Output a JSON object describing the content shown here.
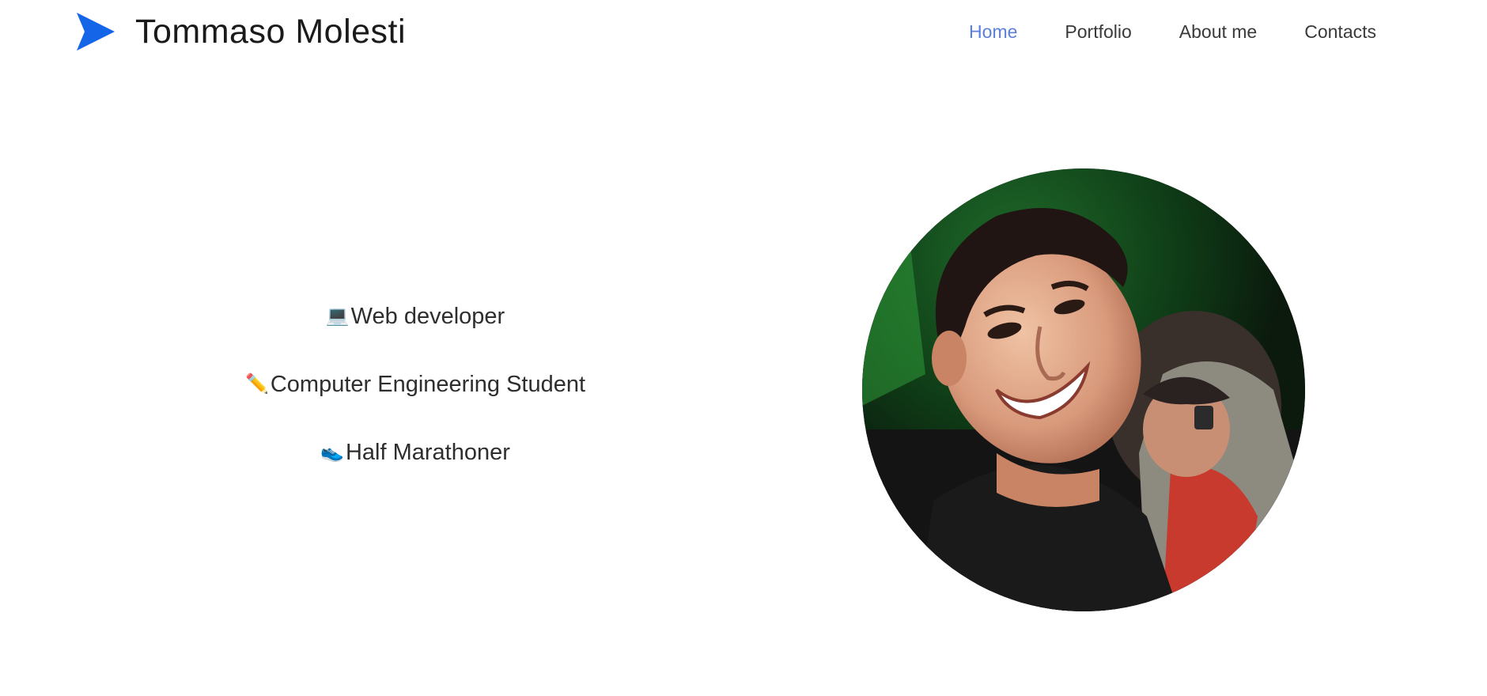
{
  "header": {
    "brand_name": "Tommaso Molesti",
    "logo_icon": "arrowhead-icon",
    "logo_color": "#1565e8"
  },
  "nav": {
    "items": [
      {
        "label": "Home",
        "active": true
      },
      {
        "label": "Portfolio",
        "active": false
      },
      {
        "label": "About me",
        "active": false
      },
      {
        "label": "Contacts",
        "active": false
      }
    ],
    "active_color": "#5b7ee0"
  },
  "main": {
    "roles": [
      {
        "emoji": "💻",
        "text": "Web developer"
      },
      {
        "emoji": "✏️",
        "text": "Computer Engineering Student"
      },
      {
        "emoji": "👟",
        "text": "Half Marathoner"
      }
    ]
  }
}
